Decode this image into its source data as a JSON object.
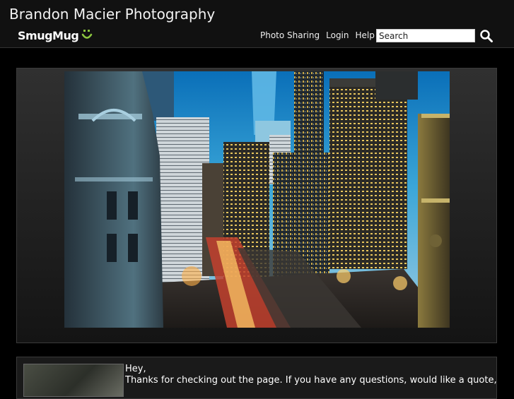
{
  "header": {
    "site_title": "Brandon Macier Photography",
    "logo_text": "SmugMug",
    "logo_accent_color": "#8cc63f"
  },
  "nav": {
    "items": [
      {
        "label": "Photo Sharing"
      },
      {
        "label": "Login"
      },
      {
        "label": "Help"
      }
    ]
  },
  "search": {
    "placeholder": "Search",
    "icon": "search-icon"
  },
  "gallery": {
    "photo_description_icon": "city-night-photo"
  },
  "bio": {
    "greeting": "Hey,",
    "text": "Thanks for checking out the page. If you have any questions, would like a quote,"
  },
  "colors": {
    "background": "#000000",
    "header_bg": "#111111",
    "panel_border": "#3a3a3a"
  }
}
